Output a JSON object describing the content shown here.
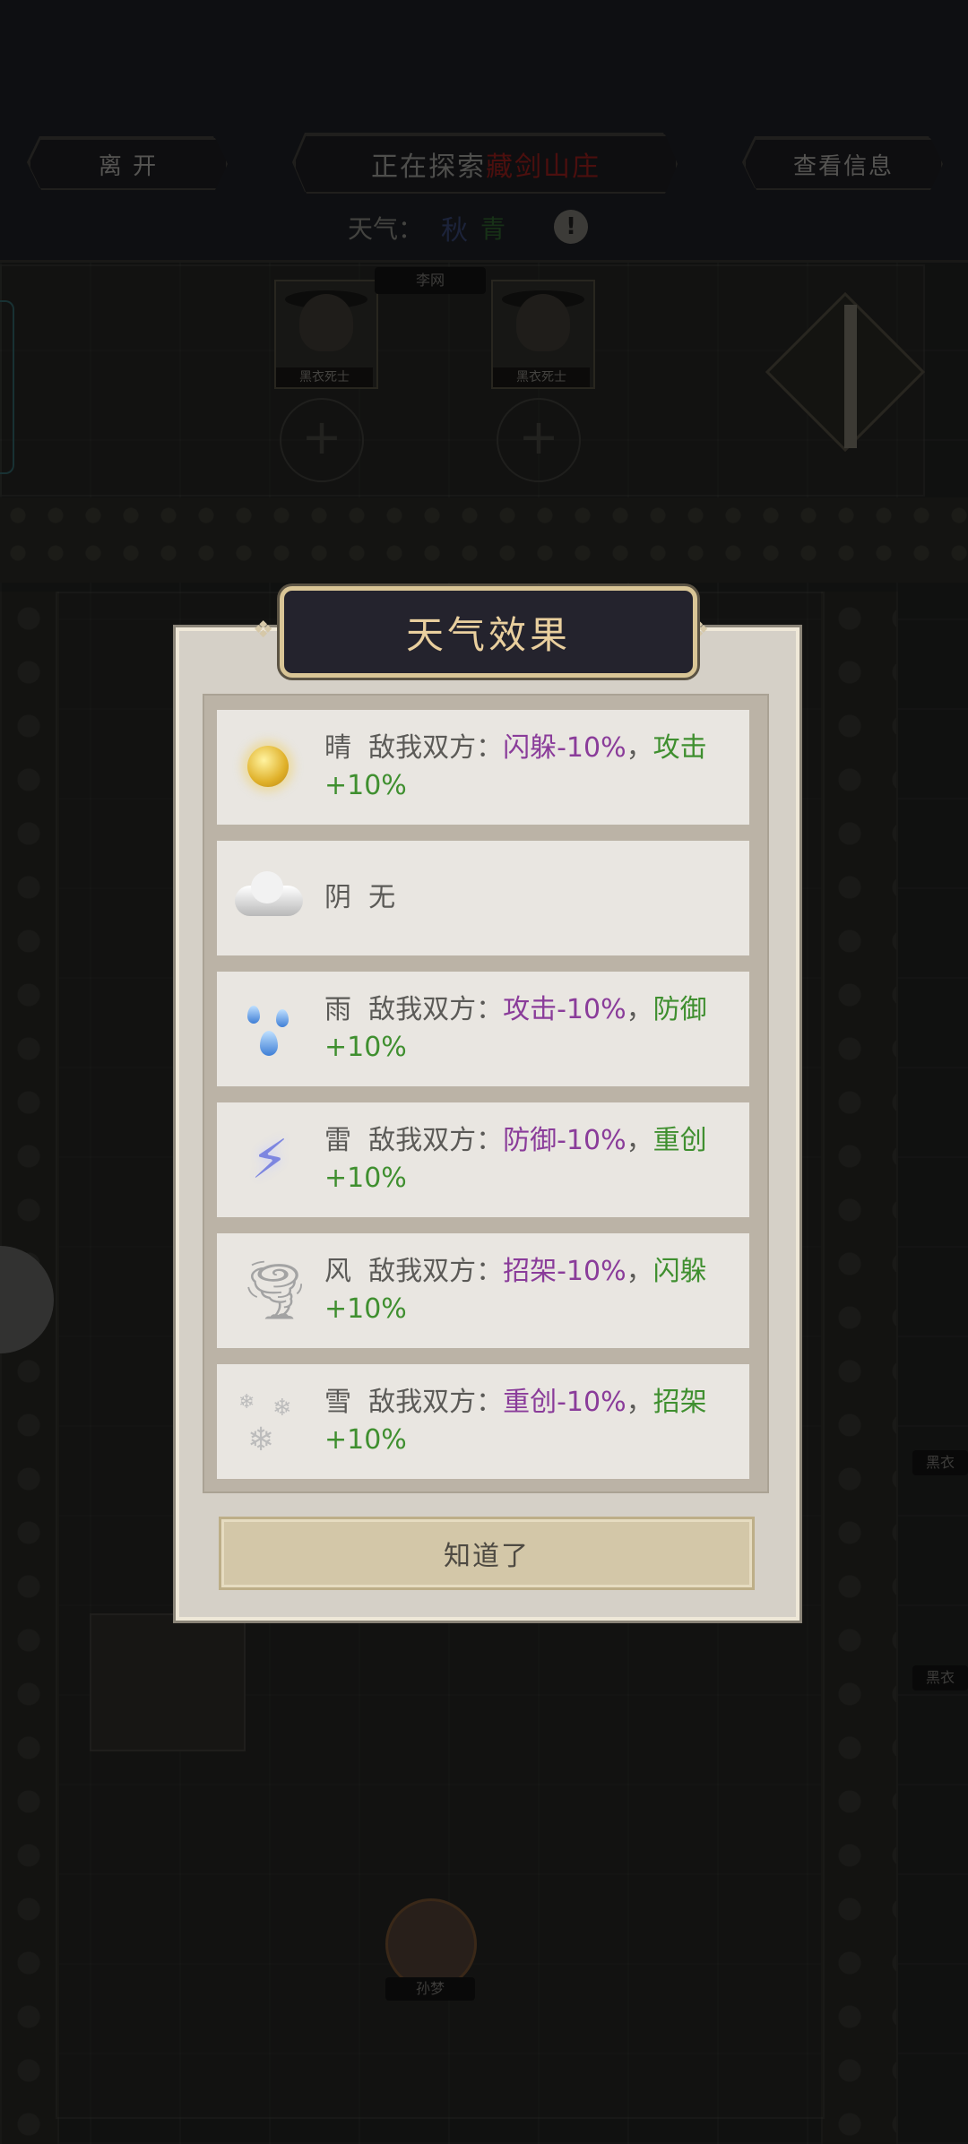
{
  "topbar": {
    "leave_label": "离 开",
    "exploring_prefix": "正在探索",
    "exploring_place": "藏剑山庄",
    "view_info_label": "查看信息",
    "weather_label": "天气：",
    "weather_icon_a": "秋",
    "weather_icon_b": "青",
    "info_icon": "!"
  },
  "map": {
    "units": [
      {
        "tag": "黑衣死士"
      },
      {
        "tag": "黑衣死士"
      }
    ],
    "top_name_tag": "李网",
    "hero_name_tag": "孙梦",
    "side_unit_tags": [
      "黑衣",
      "黑衣"
    ],
    "plus_glyph": "+"
  },
  "dialog": {
    "title": "天气效果",
    "weathers": [
      {
        "name": "晴",
        "icon": "sun-icon",
        "prefix": "敌我双方：",
        "neg": "闪躲-10%",
        "sep": "，",
        "pos": "攻击+10%"
      },
      {
        "name": "阴",
        "icon": "cloud-icon",
        "prefix": "无",
        "neg": "",
        "sep": "",
        "pos": ""
      },
      {
        "name": "雨",
        "icon": "rain-icon",
        "prefix": "敌我双方：",
        "neg": "攻击-10%",
        "sep": "，",
        "pos": "防御+10%"
      },
      {
        "name": "雷",
        "icon": "thunder-icon",
        "prefix": "敌我双方：",
        "neg": "防御-10%",
        "sep": "，",
        "pos": "重创+10%"
      },
      {
        "name": "风",
        "icon": "wind-icon",
        "prefix": "敌我双方：",
        "neg": "招架-10%",
        "sep": "，",
        "pos": "闪躲+10%"
      },
      {
        "name": "雪",
        "icon": "snow-icon",
        "prefix": "敌我双方：",
        "neg": "重创-10%",
        "sep": "，",
        "pos": "招架+10%"
      }
    ],
    "confirm_label": "知道了"
  },
  "colors": {
    "debuff": "#8a3c9a",
    "buff": "#3f8f2f",
    "title_gold": "#e9cf9e",
    "place_red": "#8b1d1b"
  }
}
